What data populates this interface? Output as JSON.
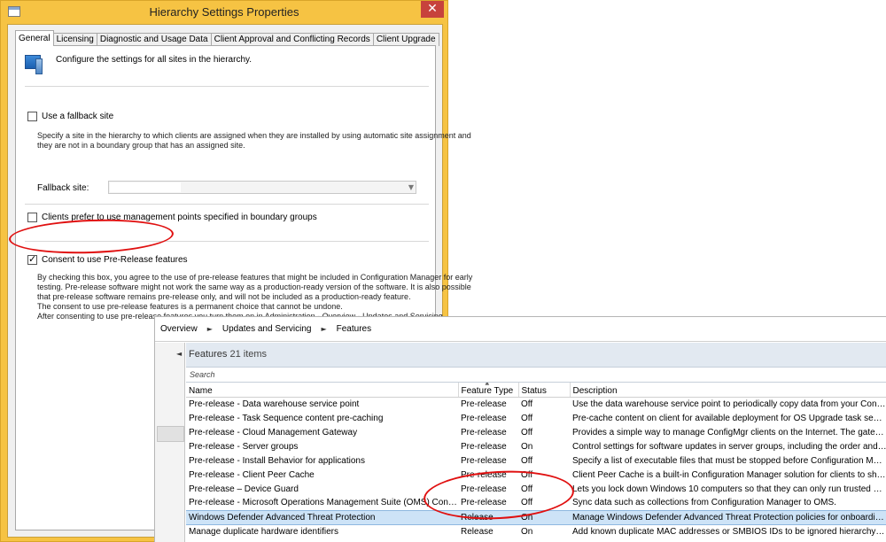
{
  "dialog": {
    "title": "Hierarchy Settings Properties",
    "close_glyph": "✕",
    "tabs": [
      {
        "label": "General",
        "active": true
      },
      {
        "label": "Licensing",
        "active": false
      },
      {
        "label": "Diagnostic and Usage Data",
        "active": false
      },
      {
        "label": "Client Approval and Conflicting Records",
        "active": false
      },
      {
        "label": "Client Upgrade",
        "active": false
      }
    ],
    "intro_text": "Configure the settings for all sites in the hierarchy.",
    "fallback": {
      "label": "Use a fallback site",
      "checked": false,
      "description_lines": [
        "Specify a site in the hierarchy to which clients are assigned when they are installed by using automatic site assignment and",
        "they are not in a boundary group that has an assigned site."
      ],
      "field_label": "Fallback site:"
    },
    "clients_prefer": {
      "label": "Clients prefer to use management points specified in boundary groups",
      "checked": false
    },
    "consent": {
      "label": "Consent to use Pre-Release features",
      "checked": true,
      "description_lines": [
        "By checking this box, you agree to the use of pre-release features that might be included in Configuration Manager for early",
        "testing. Pre-release software might not work the same way as a production-ready version of the software. It is also possible",
        "that pre-release software remains pre-release only, and will not be included as a production-ready feature.",
        "The consent to use pre-release features is a permanent choice that cannot be undone.",
        "After consenting to use pre-release features you turn them on in Administration - Overview - Updates and Servicing."
      ]
    }
  },
  "console": {
    "breadcrumb": [
      "Overview",
      "Updates and Servicing",
      "Features"
    ],
    "breadcrumb_sep": "►",
    "nav_collapse_glyph": "◄",
    "list_title": "Features",
    "list_count": "21 items",
    "search_placeholder": "Search",
    "columns": [
      "Name",
      "Feature Type",
      "Status",
      "Description"
    ],
    "rows": [
      {
        "name": "Pre-release - Data warehouse service point",
        "type": "Pre-release",
        "status": "Off",
        "description": "Use the data warehouse service point to periodically copy data from your Configura..."
      },
      {
        "name": "Pre-release - Task Sequence content pre-caching",
        "type": "Pre-release",
        "status": "Off",
        "description": "Pre-cache content on client for available deployment for OS Upgrade task sequence..."
      },
      {
        "name": "Pre-release - Cloud Management Gateway",
        "type": "Pre-release",
        "status": "Off",
        "description": "Provides a simple way to manage ConfigMgr clients on the Internet. The gateway is..."
      },
      {
        "name": "Pre-release - Server groups",
        "type": "Pre-release",
        "status": "On",
        "description": "Control settings for software updates in server groups, including the order and perc..."
      },
      {
        "name": "Pre-release - Install Behavior for applications",
        "type": "Pre-release",
        "status": "Off",
        "description": "Specify a list of executable files that must be stopped before Configuration Manager..."
      },
      {
        "name": "Pre-release - Client Peer Cache",
        "type": "Pre-release",
        "status": "Off",
        "description": "Client Peer Cache is a built-in Configuration Manager solution for clients to share co..."
      },
      {
        "name": "Pre-release – Device Guard",
        "type": "Pre-release",
        "status": "Off",
        "description": "Lets you lock down Windows 10 computers so that they can only run trusted apps a..."
      },
      {
        "name": "Pre-release - Microsoft Operations Management Suite (OMS) Connector",
        "type": "Pre-release",
        "status": "Off",
        "description": "Sync data such as collections from Configuration Manager to OMS."
      },
      {
        "name": "Windows Defender Advanced Threat Protection",
        "type": "Release",
        "status": "On",
        "description": "Manage Windows Defender Advanced Threat Protection policies for onboarding an...",
        "selected": true
      },
      {
        "name": "Manage duplicate hardware identifiers",
        "type": "Release",
        "status": "On",
        "description": "Add known duplicate MAC addresses or SMBIOS IDs to be ignored hierarchy-wide f..."
      }
    ]
  },
  "colors": {
    "window_frame": "#f6c343",
    "close_button": "#c7423c",
    "annotation": "#e01010",
    "selected_row": "#cde3f7"
  },
  "icons": [
    "close-icon",
    "hierarchy-computer-icon",
    "chevron-down-icon",
    "breadcrumb-arrow-icon",
    "collapse-arrow-icon",
    "sort-arrow-icon"
  ]
}
